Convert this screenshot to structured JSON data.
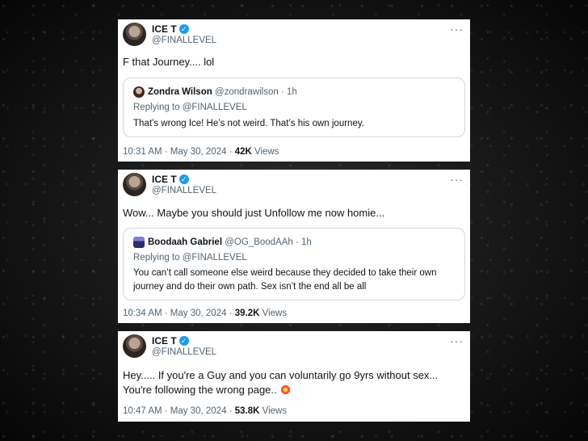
{
  "tweets": [
    {
      "author": {
        "name": "ICE T",
        "handle": "@FINALLEVEL"
      },
      "text": "F that Journey.... lol",
      "quote": {
        "name": "Zondra Wilson",
        "meta": "@zondrawilson · 1h",
        "reply": "Replying to @FINALLEVEL",
        "text": "That’s wrong Ice! He’s not weird. That’s his own journey."
      },
      "footer": {
        "time": "10:31 AM · May 30, 2024 · ",
        "views_count": "42K",
        "views_label": " Views"
      }
    },
    {
      "author": {
        "name": "ICE T",
        "handle": "@FINALLEVEL"
      },
      "text": "Wow... Maybe you should just Unfollow me now homie...",
      "quote": {
        "name": "Boodaah Gabriel",
        "meta": "@OG_BoodAAh · 1h",
        "reply": "Replying to @FINALLEVEL",
        "text": "You can’t call someone else weird because they decided to take their own journey and do their own path. Sex isn’t the end all be all"
      },
      "footer": {
        "time": "10:34 AM · May 30, 2024 · ",
        "views_count": "39.2K",
        "views_label": " Views"
      }
    },
    {
      "author": {
        "name": "ICE T",
        "handle": "@FINALLEVEL"
      },
      "text": "Hey..... If you're a Guy and you can voluntarily go 9yrs without sex... You're following the wrong page..",
      "footer": {
        "time": "10:47 AM · May 30, 2024 · ",
        "views_count": "53.8K",
        "views_label": " Views"
      }
    }
  ],
  "icons": {
    "verified": "verified-badge-icon",
    "more": "more-options-icon",
    "emoji": "collision-emoji-icon"
  },
  "colors": {
    "verified": "#1d9bf0",
    "muted": "#536471",
    "text": "#0f1419",
    "border": "#cfd9de"
  }
}
